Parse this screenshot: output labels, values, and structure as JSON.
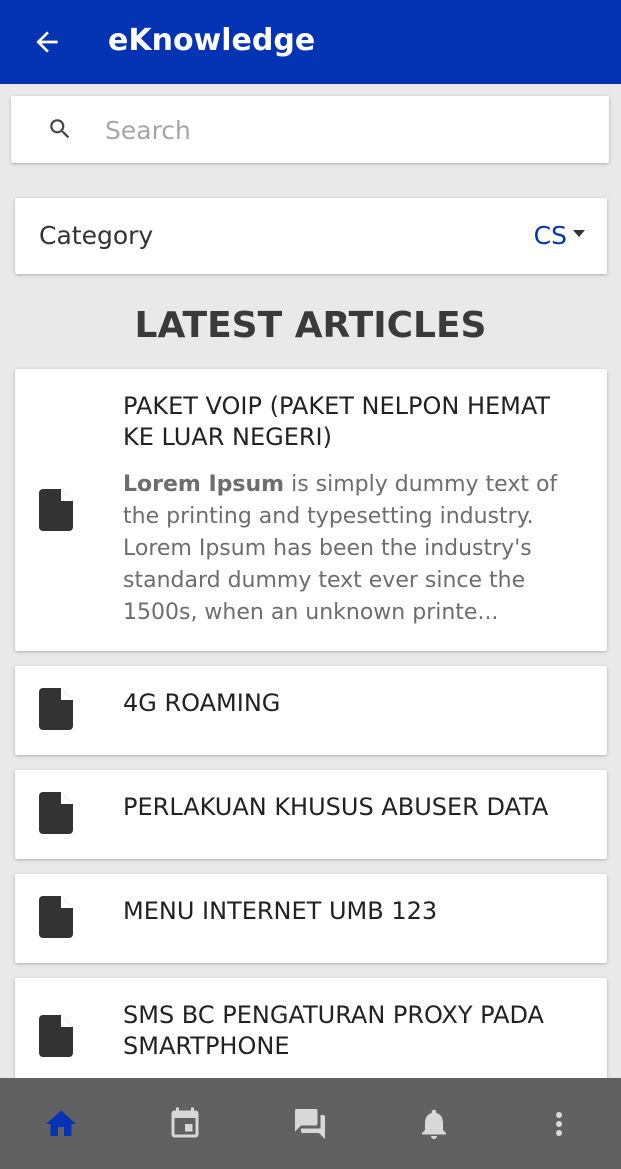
{
  "app": {
    "title": "eKnowledge",
    "colors": {
      "primary": "#0433b4",
      "background": "#e9e9e9",
      "bottom_bar": "#616161",
      "icon_inactive": "#d8d8d8"
    }
  },
  "search": {
    "placeholder": "Search",
    "value": ""
  },
  "category": {
    "label": "Category",
    "selected": "CS"
  },
  "section_title": "LATEST ARTICLES",
  "articles": [
    {
      "title": "PAKET VOIP (PAKET NELPON HEMAT KE LUAR NEGERI)",
      "excerpt_bold": "Lorem Ipsum",
      "excerpt_rest": " is simply dummy text of the printing and typesetting industry. Lorem Ipsum has been the industry's standard dummy text ever since the 1500s, when an unknown printe..."
    },
    {
      "title": "4G ROAMING"
    },
    {
      "title": "PERLAKUAN KHUSUS ABUSER DATA"
    },
    {
      "title": "MENU INTERNET UMB 123"
    },
    {
      "title": "SMS BC PENGATURAN PROXY PADA SMARTPHONE"
    }
  ],
  "bottom_nav": [
    {
      "icon": "home-icon",
      "active": true
    },
    {
      "icon": "calendar-icon",
      "active": false
    },
    {
      "icon": "forum-icon",
      "active": false
    },
    {
      "icon": "bell-icon",
      "active": false
    },
    {
      "icon": "more-vert-icon",
      "active": false
    }
  ]
}
